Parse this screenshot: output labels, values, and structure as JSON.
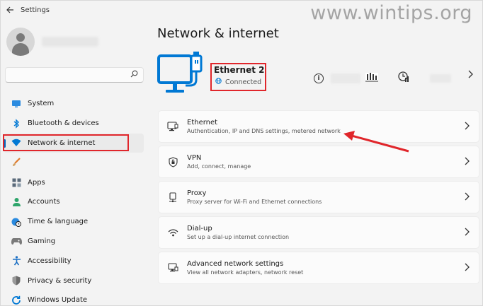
{
  "window": {
    "back_icon": "back-arrow-icon",
    "title": "Settings",
    "watermark": "www.wintips.org"
  },
  "sidebar": {
    "search": {
      "value": "",
      "placeholder": ""
    },
    "items": [
      {
        "id": "system",
        "label": "System",
        "icon": "monitor-icon",
        "color": "#0078d4"
      },
      {
        "id": "bluetooth",
        "label": "Bluetooth & devices",
        "icon": "bluetooth-icon",
        "color": "#0078d4"
      },
      {
        "id": "network",
        "label": "Network & internet",
        "icon": "wifi-icon",
        "color": "#0078d4",
        "active": true
      },
      {
        "id": "personalization",
        "label": "",
        "icon": "brush-icon",
        "color": "#e07a2c"
      },
      {
        "id": "apps",
        "label": "Apps",
        "icon": "apps-icon",
        "color": "#5a6a7a"
      },
      {
        "id": "accounts",
        "label": "Accounts",
        "icon": "person-icon",
        "color": "#2ea56b"
      },
      {
        "id": "time",
        "label": "Time & language",
        "icon": "globe-clock-icon",
        "color": "#0078d4"
      },
      {
        "id": "gaming",
        "label": "Gaming",
        "icon": "gamepad-icon",
        "color": "#6b6b6b"
      },
      {
        "id": "accessibility",
        "label": "Accessibility",
        "icon": "accessibility-icon",
        "color": "#1a6fc4"
      },
      {
        "id": "privacy",
        "label": "Privacy & security",
        "icon": "shield-icon",
        "color": "#6b6b6b"
      },
      {
        "id": "update",
        "label": "Windows Update",
        "icon": "update-icon",
        "color": "#0078d4"
      }
    ]
  },
  "main": {
    "title": "Network & internet",
    "device": {
      "name": "Ethernet 2",
      "status": "Connected",
      "icon": "ethernet-pc-icon",
      "accent": "#0078d4"
    },
    "cards": [
      {
        "id": "ethernet",
        "title": "Ethernet",
        "subtitle": "Authentication, IP and DNS settings, metered network",
        "icon": "ethernet-icon"
      },
      {
        "id": "vpn",
        "title": "VPN",
        "subtitle": "Add, connect, manage",
        "icon": "vpn-shield-icon"
      },
      {
        "id": "proxy",
        "title": "Proxy",
        "subtitle": "Proxy server for Wi-Fi and Ethernet connections",
        "icon": "proxy-icon"
      },
      {
        "id": "dialup",
        "title": "Dial-up",
        "subtitle": "Set up a dial-up internet connection",
        "icon": "dialup-icon"
      },
      {
        "id": "advanced",
        "title": "Advanced network settings",
        "subtitle": "View all network adapters, network reset",
        "icon": "network-adapter-icon"
      }
    ]
  },
  "annotations": {
    "highlight_color": "#e0262b"
  }
}
